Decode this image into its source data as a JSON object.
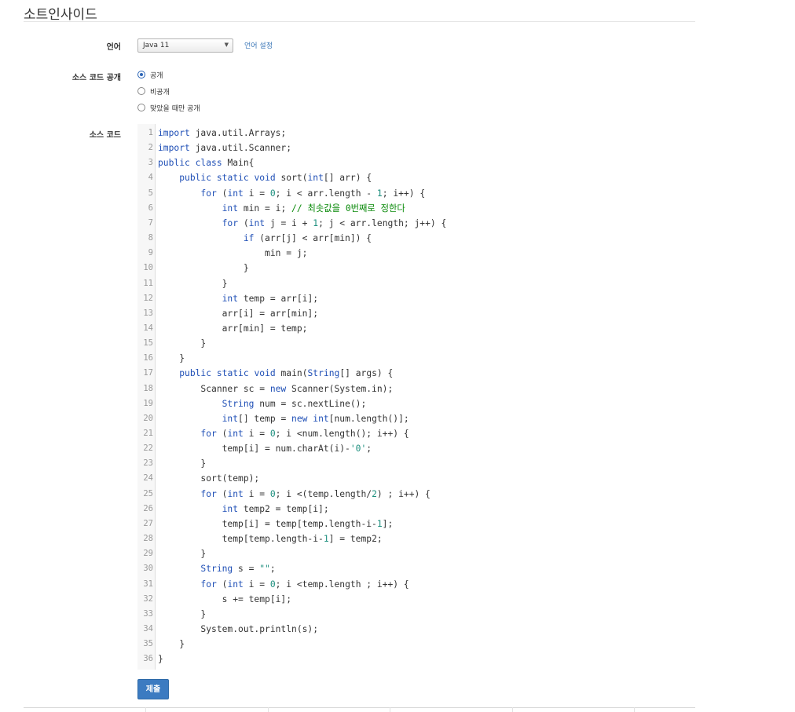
{
  "header": {
    "title": "소트인사이드"
  },
  "form": {
    "language_label": "언어",
    "language_value": "Java 11",
    "language_settings_link": "언어 설정",
    "visibility_label": "소스 코드 공개",
    "visibility_options": [
      {
        "label": "공개",
        "selected": true
      },
      {
        "label": "비공개",
        "selected": false
      },
      {
        "label": "맞았을 때만 공개",
        "selected": false
      }
    ],
    "source_label": "소스 코드",
    "submit_label": "제출"
  },
  "code_lines": [
    "import java.util.Arrays;",
    "import java.util.Scanner;",
    "public class Main{",
    "    public static void sort(int[] arr) {",
    "        for (int i = 0; i < arr.length - 1; i++) {",
    "            int min = i; // 최솟값을 0번째로 정한다",
    "            for (int j = i + 1; j < arr.length; j++) {",
    "                if (arr[j] < arr[min]) {",
    "                    min = j;",
    "                }",
    "            }",
    "            int temp = arr[i];",
    "            arr[i] = arr[min];",
    "            arr[min] = temp;",
    "        }",
    "    }",
    "    public static void main(String[] args) {",
    "        Scanner sc = new Scanner(System.in);",
    "            String num = sc.nextLine();",
    "            int[] temp = new int[num.length()];",
    "        for (int i = 0; i <num.length(); i++) {",
    "            temp[i] = num.charAt(i)-'0';",
    "        }",
    "        sort(temp);",
    "        for (int i = 0; i <(temp.length/2) ; i++) {",
    "            int temp2 = temp[i];",
    "            temp[i] = temp[temp.length-i-1];",
    "            temp[temp.length-i-1] = temp2;",
    "        }",
    "        String s = \"\";",
    "        for (int i = 0; i <temp.length ; i++) {",
    "            s += temp[i];",
    "        }",
    "        System.out.println(s);",
    "    }",
    "}"
  ],
  "colors": {
    "keyword": "#1f4fb6",
    "comment": "#0a8a0a",
    "number": "#1d8f7e",
    "button": "#3c7bc1"
  }
}
